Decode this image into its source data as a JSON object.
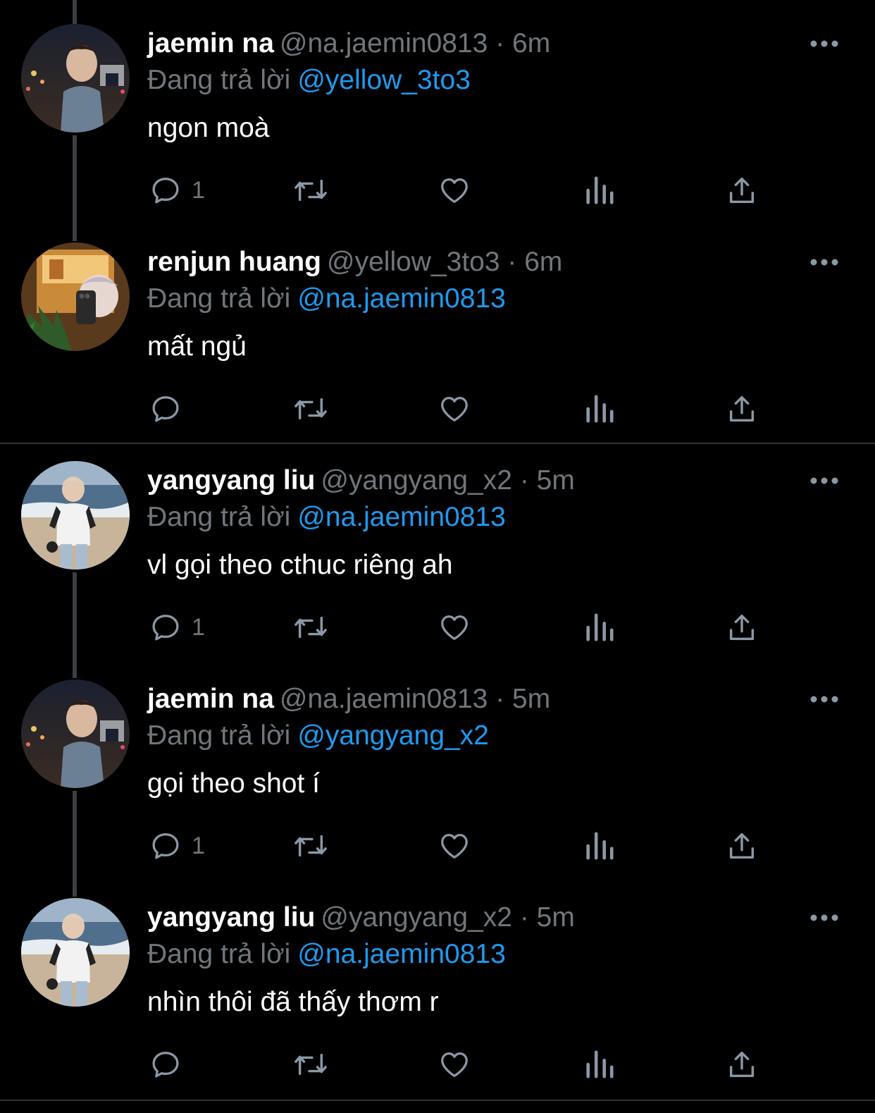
{
  "tweets": [
    {
      "name": "jaemin na",
      "handle_time": "@na.jaemin0813 · 6m",
      "reply_prefix": "Đang trả lời",
      "reply_to": "@yellow_3to3",
      "text": "ngon moà",
      "reply_count": "1",
      "avatar": "night-city-portrait"
    },
    {
      "name": "renjun huang",
      "handle_time": "@yellow_3to3 · 6m",
      "reply_prefix": "Đang trả lời",
      "reply_to": "@na.jaemin0813",
      "text": "mất ngủ",
      "reply_count": "",
      "avatar": "mirror-selfie"
    },
    {
      "name": "yangyang liu",
      "handle_time": "@yangyang_x2 · 5m",
      "reply_prefix": "Đang trả lời",
      "reply_to": "@na.jaemin0813",
      "text": "vl gọi theo cthuc riêng ah",
      "reply_count": "1",
      "avatar": "beach-portrait"
    },
    {
      "name": "jaemin na",
      "handle_time": "@na.jaemin0813 · 5m",
      "reply_prefix": "Đang trả lời",
      "reply_to": "@yangyang_x2",
      "text": "gọi theo shot í",
      "reply_count": "1",
      "avatar": "night-city-portrait"
    },
    {
      "name": "yangyang liu",
      "handle_time": "@yangyang_x2 · 5m",
      "reply_prefix": "Đang trả lời",
      "reply_to": "@na.jaemin0813",
      "text": "nhìn thôi đã thấy thơm r",
      "reply_count": "",
      "avatar": "beach-portrait"
    }
  ],
  "icons": {
    "reply": "reply-icon",
    "retweet": "retweet-icon",
    "like": "heart-icon",
    "views": "views-icon",
    "share": "share-icon",
    "more": "more-icon"
  },
  "colors": {
    "background": "#000000",
    "name": "#ffffff",
    "secondary": "#71767b",
    "mention": "#1d9bf0",
    "divider": "#2f3336"
  }
}
